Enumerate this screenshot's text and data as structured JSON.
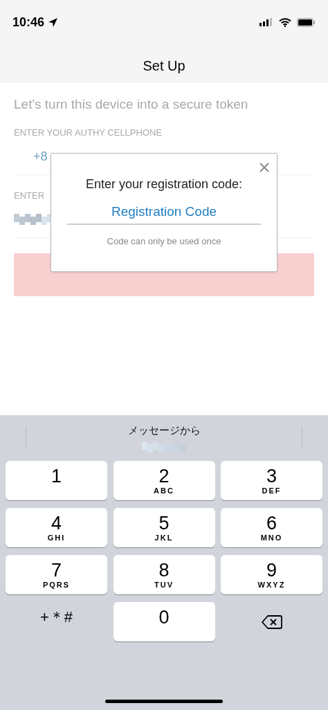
{
  "status_bar": {
    "time": "10:46"
  },
  "nav": {
    "title": "Set Up"
  },
  "form": {
    "heading": "Let's turn this device into a secure token",
    "phone_label": "ENTER YOUR AUTHY CELLPHONE",
    "country_code": "+8",
    "second_label": "ENTER"
  },
  "dialog": {
    "title": "Enter your registration code:",
    "placeholder": "Registration Code",
    "hint": "Code can only be used once"
  },
  "keyboard": {
    "suggestion": "メッセージから",
    "keys": [
      {
        "kind": "key",
        "digit": "1"
      },
      {
        "kind": "key",
        "digit": "2",
        "letters": "ABC"
      },
      {
        "kind": "key",
        "digit": "3",
        "letters": "DEF"
      },
      {
        "kind": "key",
        "digit": "4",
        "letters": "GHI"
      },
      {
        "kind": "key",
        "digit": "5",
        "letters": "JKL"
      },
      {
        "kind": "key",
        "digit": "6",
        "letters": "MNO"
      },
      {
        "kind": "key",
        "digit": "7",
        "letters": "PQRS"
      },
      {
        "kind": "key",
        "digit": "8",
        "letters": "TUV"
      },
      {
        "kind": "key",
        "digit": "9",
        "letters": "WXYZ"
      },
      {
        "kind": "symbols",
        "label": "+＊#"
      },
      {
        "kind": "key",
        "digit": "0"
      },
      {
        "kind": "delete"
      }
    ]
  }
}
